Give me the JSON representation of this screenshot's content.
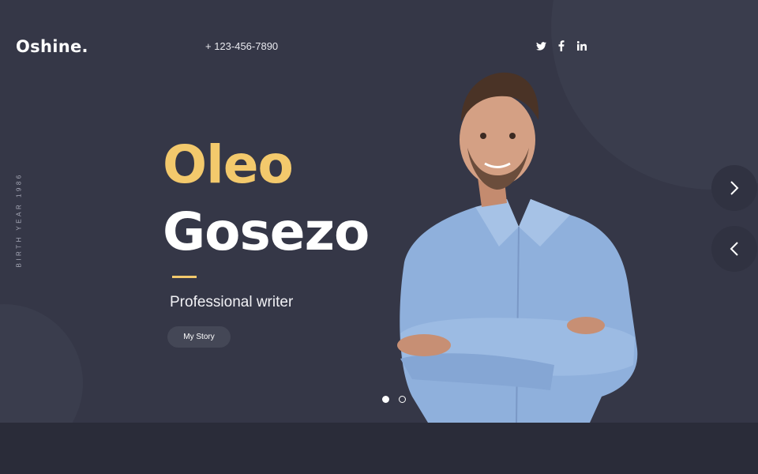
{
  "header": {
    "logo": "Oshine.",
    "phone": "+ 123-456-7890",
    "socials": [
      {
        "icon": "twitter-icon"
      },
      {
        "icon": "facebook-icon"
      },
      {
        "icon": "linkedin-icon"
      }
    ]
  },
  "hero": {
    "side_label": "BIRTH YEAR  1986",
    "first_name": "Oleo",
    "last_name": "Gosezo",
    "role": "Professional writer",
    "cta_label": "My Story",
    "slides_total": 2,
    "slide_active": 1
  },
  "colors": {
    "background": "#353747",
    "accent": "#f3c96c",
    "shirt": "#8fb0dc"
  },
  "icons": {
    "next": "chevron-right-icon",
    "prev": "chevron-left-icon"
  }
}
